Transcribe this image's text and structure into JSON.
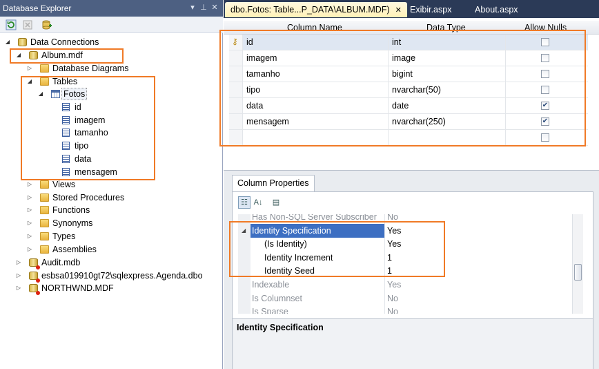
{
  "left_panel": {
    "title": "Database Explorer",
    "title_icons": [
      "dropdown-icon",
      "pin-icon",
      "close-icon"
    ],
    "toolbar": [
      "refresh-icon",
      "stop-icon",
      "connect-to-database-icon"
    ],
    "tree": {
      "root": "Data Connections",
      "album": "Album.mdf",
      "database_diagrams": "Database Diagrams",
      "tables": "Tables",
      "fotos": "Fotos",
      "columns": [
        "id",
        "imagem",
        "tamanho",
        "tipo",
        "data",
        "mensagem"
      ],
      "other_folders": [
        "Views",
        "Stored Procedures",
        "Functions",
        "Synonyms",
        "Types",
        "Assemblies"
      ],
      "other_connections": [
        "Audit.mdb",
        "esbsa019910gt72\\sqlexpress.Agenda.dbo",
        "NORTHWND.MDF"
      ]
    }
  },
  "doc_tabs": {
    "active": "dbo.Fotos: Table...P_DATA\\ALBUM.MDF)",
    "others": [
      "Exibir.aspx",
      "About.aspx"
    ]
  },
  "designer": {
    "headers": [
      "Column Name",
      "Data Type",
      "Allow Nulls"
    ],
    "rows": [
      {
        "name": "id",
        "type": "int",
        "nulls": false,
        "key": true
      },
      {
        "name": "imagem",
        "type": "image",
        "nulls": false
      },
      {
        "name": "tamanho",
        "type": "bigint",
        "nulls": false
      },
      {
        "name": "tipo",
        "type": "nvarchar(50)",
        "nulls": false
      },
      {
        "name": "data",
        "type": "date",
        "nulls": true
      },
      {
        "name": "mensagem",
        "type": "nvarchar(250)",
        "nulls": true
      },
      {
        "name": "",
        "type": "",
        "nulls": false
      }
    ]
  },
  "column_properties": {
    "tab": "Column Properties",
    "rows": [
      {
        "name": "Has Non-SQL Server Subscriber",
        "value": "No",
        "gray": true
      },
      {
        "name": "Identity Specification",
        "value": "Yes",
        "selected": true,
        "expanded": true
      },
      {
        "name": "(Is Identity)",
        "value": "Yes"
      },
      {
        "name": "Identity Increment",
        "value": "1"
      },
      {
        "name": "Identity Seed",
        "value": "1"
      },
      {
        "name": "Indexable",
        "value": "Yes",
        "gray": true
      },
      {
        "name": "Is Columnset",
        "value": "No",
        "gray": true
      },
      {
        "name": "Is Sparse",
        "value": "No",
        "gray": true
      }
    ],
    "description_title": "Identity Specification"
  },
  "colors": {
    "highlight": "#f07a26",
    "title_bar": "#4d6082",
    "selection": "#3d6fc2"
  }
}
